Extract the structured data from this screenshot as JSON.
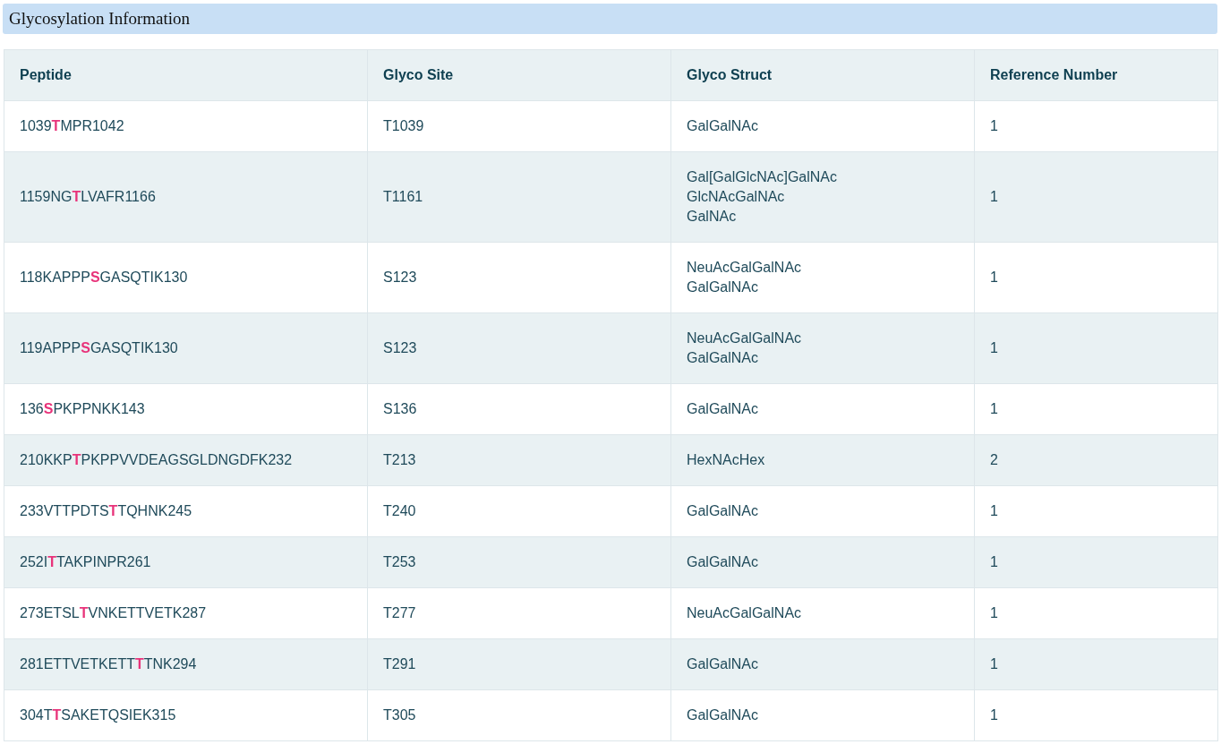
{
  "section": {
    "title": "Glycosylation Information"
  },
  "table": {
    "columns": [
      "Peptide",
      "Glyco Site",
      "Glyco Struct",
      "Reference Number"
    ],
    "rows": [
      {
        "peptide": "1039**T**MPR1042",
        "glyco_site": "T1039",
        "glyco_struct": [
          "GalGalNAc"
        ],
        "reference_number": "1"
      },
      {
        "peptide": "1159NG**T**LVAFR1166",
        "glyco_site": "T1161",
        "glyco_struct": [
          "Gal[GalGlcNAc]GalNAc",
          "GlcNAcGalNAc",
          "GalNAc"
        ],
        "reference_number": "1"
      },
      {
        "peptide": "118KAPPP**S**GASQTIK130",
        "glyco_site": "S123",
        "glyco_struct": [
          "NeuAcGalGalNAc",
          "GalGalNAc"
        ],
        "reference_number": "1"
      },
      {
        "peptide": "119APPP**S**GASQTIK130",
        "glyco_site": "S123",
        "glyco_struct": [
          "NeuAcGalGalNAc",
          "GalGalNAc"
        ],
        "reference_number": "1"
      },
      {
        "peptide": "136**S**PKPPNKK143",
        "glyco_site": "S136",
        "glyco_struct": [
          "GalGalNAc"
        ],
        "reference_number": "1"
      },
      {
        "peptide": "210KKP**T**PKPPVVDEAGSGLDNGDFK232",
        "glyco_site": "T213",
        "glyco_struct": [
          "HexNAcHex"
        ],
        "reference_number": "2"
      },
      {
        "peptide": "233VTTPDTS**T**TQHNK245",
        "glyco_site": "T240",
        "glyco_struct": [
          "GalGalNAc"
        ],
        "reference_number": "1"
      },
      {
        "peptide": "252I**T**TAKPINPR261",
        "glyco_site": "T253",
        "glyco_struct": [
          "GalGalNAc"
        ],
        "reference_number": "1"
      },
      {
        "peptide": "273ETSL**T**VNKETTVETK287",
        "glyco_site": "T277",
        "glyco_struct": [
          "NeuAcGalGalNAc"
        ],
        "reference_number": "1"
      },
      {
        "peptide": "281ETTVETKETT**T**TNK294",
        "glyco_site": "T291",
        "glyco_struct": [
          "GalGalNAc"
        ],
        "reference_number": "1"
      },
      {
        "peptide": "304T**T**SAKETQSIEK315",
        "glyco_site": "T305",
        "glyco_struct": [
          "GalGalNAc"
        ],
        "reference_number": "1"
      }
    ]
  }
}
